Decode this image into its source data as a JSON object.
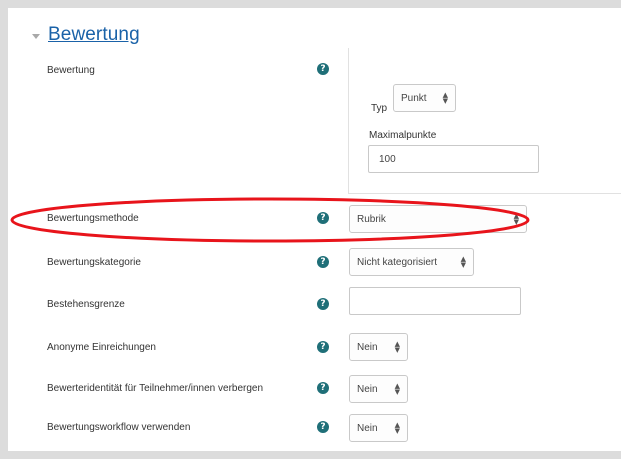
{
  "section": {
    "title": "Bewertung"
  },
  "grade": {
    "label": "Bewertung",
    "type_label": "Typ",
    "type_value": "Punkt",
    "max_label": "Maximalpunkte",
    "max_value": "100"
  },
  "rows": {
    "method": {
      "label": "Bewertungsmethode",
      "value": "Rubrik"
    },
    "category": {
      "label": "Bewertungskategorie",
      "value": "Nicht kategorisiert"
    },
    "pass": {
      "label": "Bestehensgrenze",
      "value": ""
    },
    "anon": {
      "label": "Anonyme Einreichungen",
      "value": "Nein"
    },
    "hide": {
      "label": "Bewerteridentität für Teilnehmer/innen verbergen",
      "value": "Nein"
    },
    "workflow": {
      "label": "Bewertungsworkflow verwenden",
      "value": "Nein"
    }
  },
  "help_glyph": "?",
  "select_arrows": "▲\n▼",
  "colors": {
    "accent": "#1a62a8",
    "help": "#1f6f78",
    "highlight": "#e8141b"
  }
}
